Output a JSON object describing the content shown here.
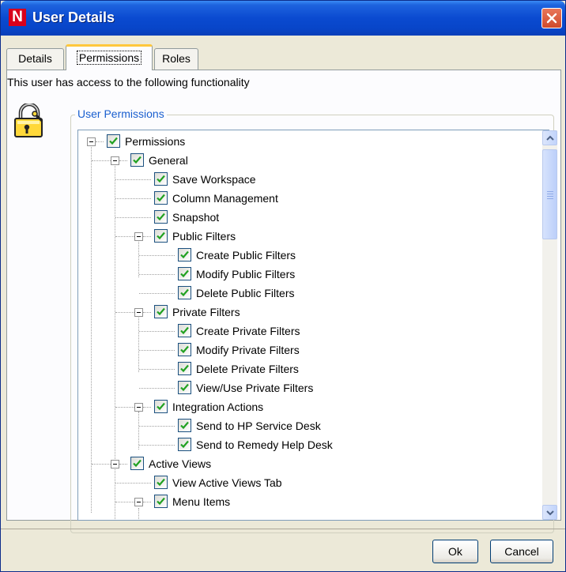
{
  "window": {
    "app_logo": "N",
    "title": "User Details",
    "close_icon": "close-icon"
  },
  "tabs": [
    {
      "label": "Details",
      "active": false
    },
    {
      "label": "Permissions",
      "active": true
    },
    {
      "label": "Roles",
      "active": false
    }
  ],
  "info_text": "This user has access to the following functionality",
  "lock_icon": "padlock-key-icon",
  "group_title": "User Permissions",
  "tree": [
    {
      "label": "Permissions",
      "level": 0,
      "checked": true,
      "expanded": true
    },
    {
      "label": "General",
      "level": 1,
      "checked": true,
      "expanded": true
    },
    {
      "label": "Save Workspace",
      "level": 2,
      "checked": true
    },
    {
      "label": "Column Management",
      "level": 2,
      "checked": true
    },
    {
      "label": "Snapshot",
      "level": 2,
      "checked": true
    },
    {
      "label": "Public Filters",
      "level": 2,
      "checked": true,
      "expanded": true
    },
    {
      "label": "Create Public Filters",
      "level": 3,
      "checked": true
    },
    {
      "label": "Modify Public Filters",
      "level": 3,
      "checked": true
    },
    {
      "label": "Delete Public Filters",
      "level": 3,
      "checked": true
    },
    {
      "label": "Private Filters",
      "level": 2,
      "checked": true,
      "expanded": true
    },
    {
      "label": "Create Private Filters",
      "level": 3,
      "checked": true
    },
    {
      "label": "Modify Private Filters",
      "level": 3,
      "checked": true
    },
    {
      "label": "Delete Private Filters",
      "level": 3,
      "checked": true
    },
    {
      "label": "View/Use Private Filters",
      "level": 3,
      "checked": true
    },
    {
      "label": "Integration Actions",
      "level": 2,
      "checked": true,
      "expanded": true
    },
    {
      "label": "Send to HP Service Desk",
      "level": 3,
      "checked": true
    },
    {
      "label": "Send to Remedy Help Desk",
      "level": 3,
      "checked": true
    },
    {
      "label": "Active Views",
      "level": 1,
      "checked": true,
      "expanded": true
    },
    {
      "label": "View Active Views Tab",
      "level": 2,
      "checked": true
    },
    {
      "label": "Menu Items",
      "level": 2,
      "checked": true,
      "expanded": true
    }
  ],
  "scrollbar": {
    "up_icon": "scroll-up-arrow-icon",
    "down_icon": "scroll-down-arrow-icon"
  },
  "buttons": {
    "ok": "Ok",
    "cancel": "Cancel"
  }
}
